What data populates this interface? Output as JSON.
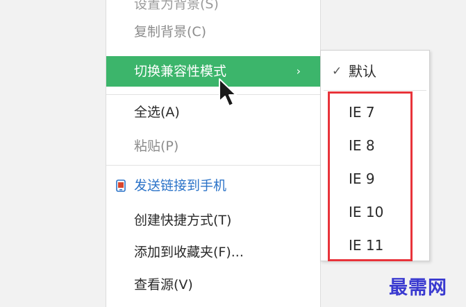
{
  "main_menu": {
    "items": [
      {
        "label": "设置为背景(S)"
      },
      {
        "label": "复制背景(C)"
      },
      {
        "label": "切换兼容性模式",
        "arrow": "›"
      },
      {
        "label": "全选(A)"
      },
      {
        "label": "粘贴(P)"
      },
      {
        "label": "发送链接到手机",
        "icon": "phone-icon"
      },
      {
        "label": "创建快捷方式(T)"
      },
      {
        "label": "添加到收藏夹(F)..."
      },
      {
        "label": "查看源(V)"
      }
    ]
  },
  "submenu": {
    "default": {
      "check": "✓",
      "label": "默认"
    },
    "items": [
      "IE 7",
      "IE 8",
      "IE 9",
      "IE 10",
      "IE 11"
    ]
  },
  "watermark": "最需网",
  "colors": {
    "highlight": "#3cb56b",
    "highlight_box": "#e8333a",
    "watermark": "#3a3ad0",
    "link_blue": "#2b73c8"
  }
}
